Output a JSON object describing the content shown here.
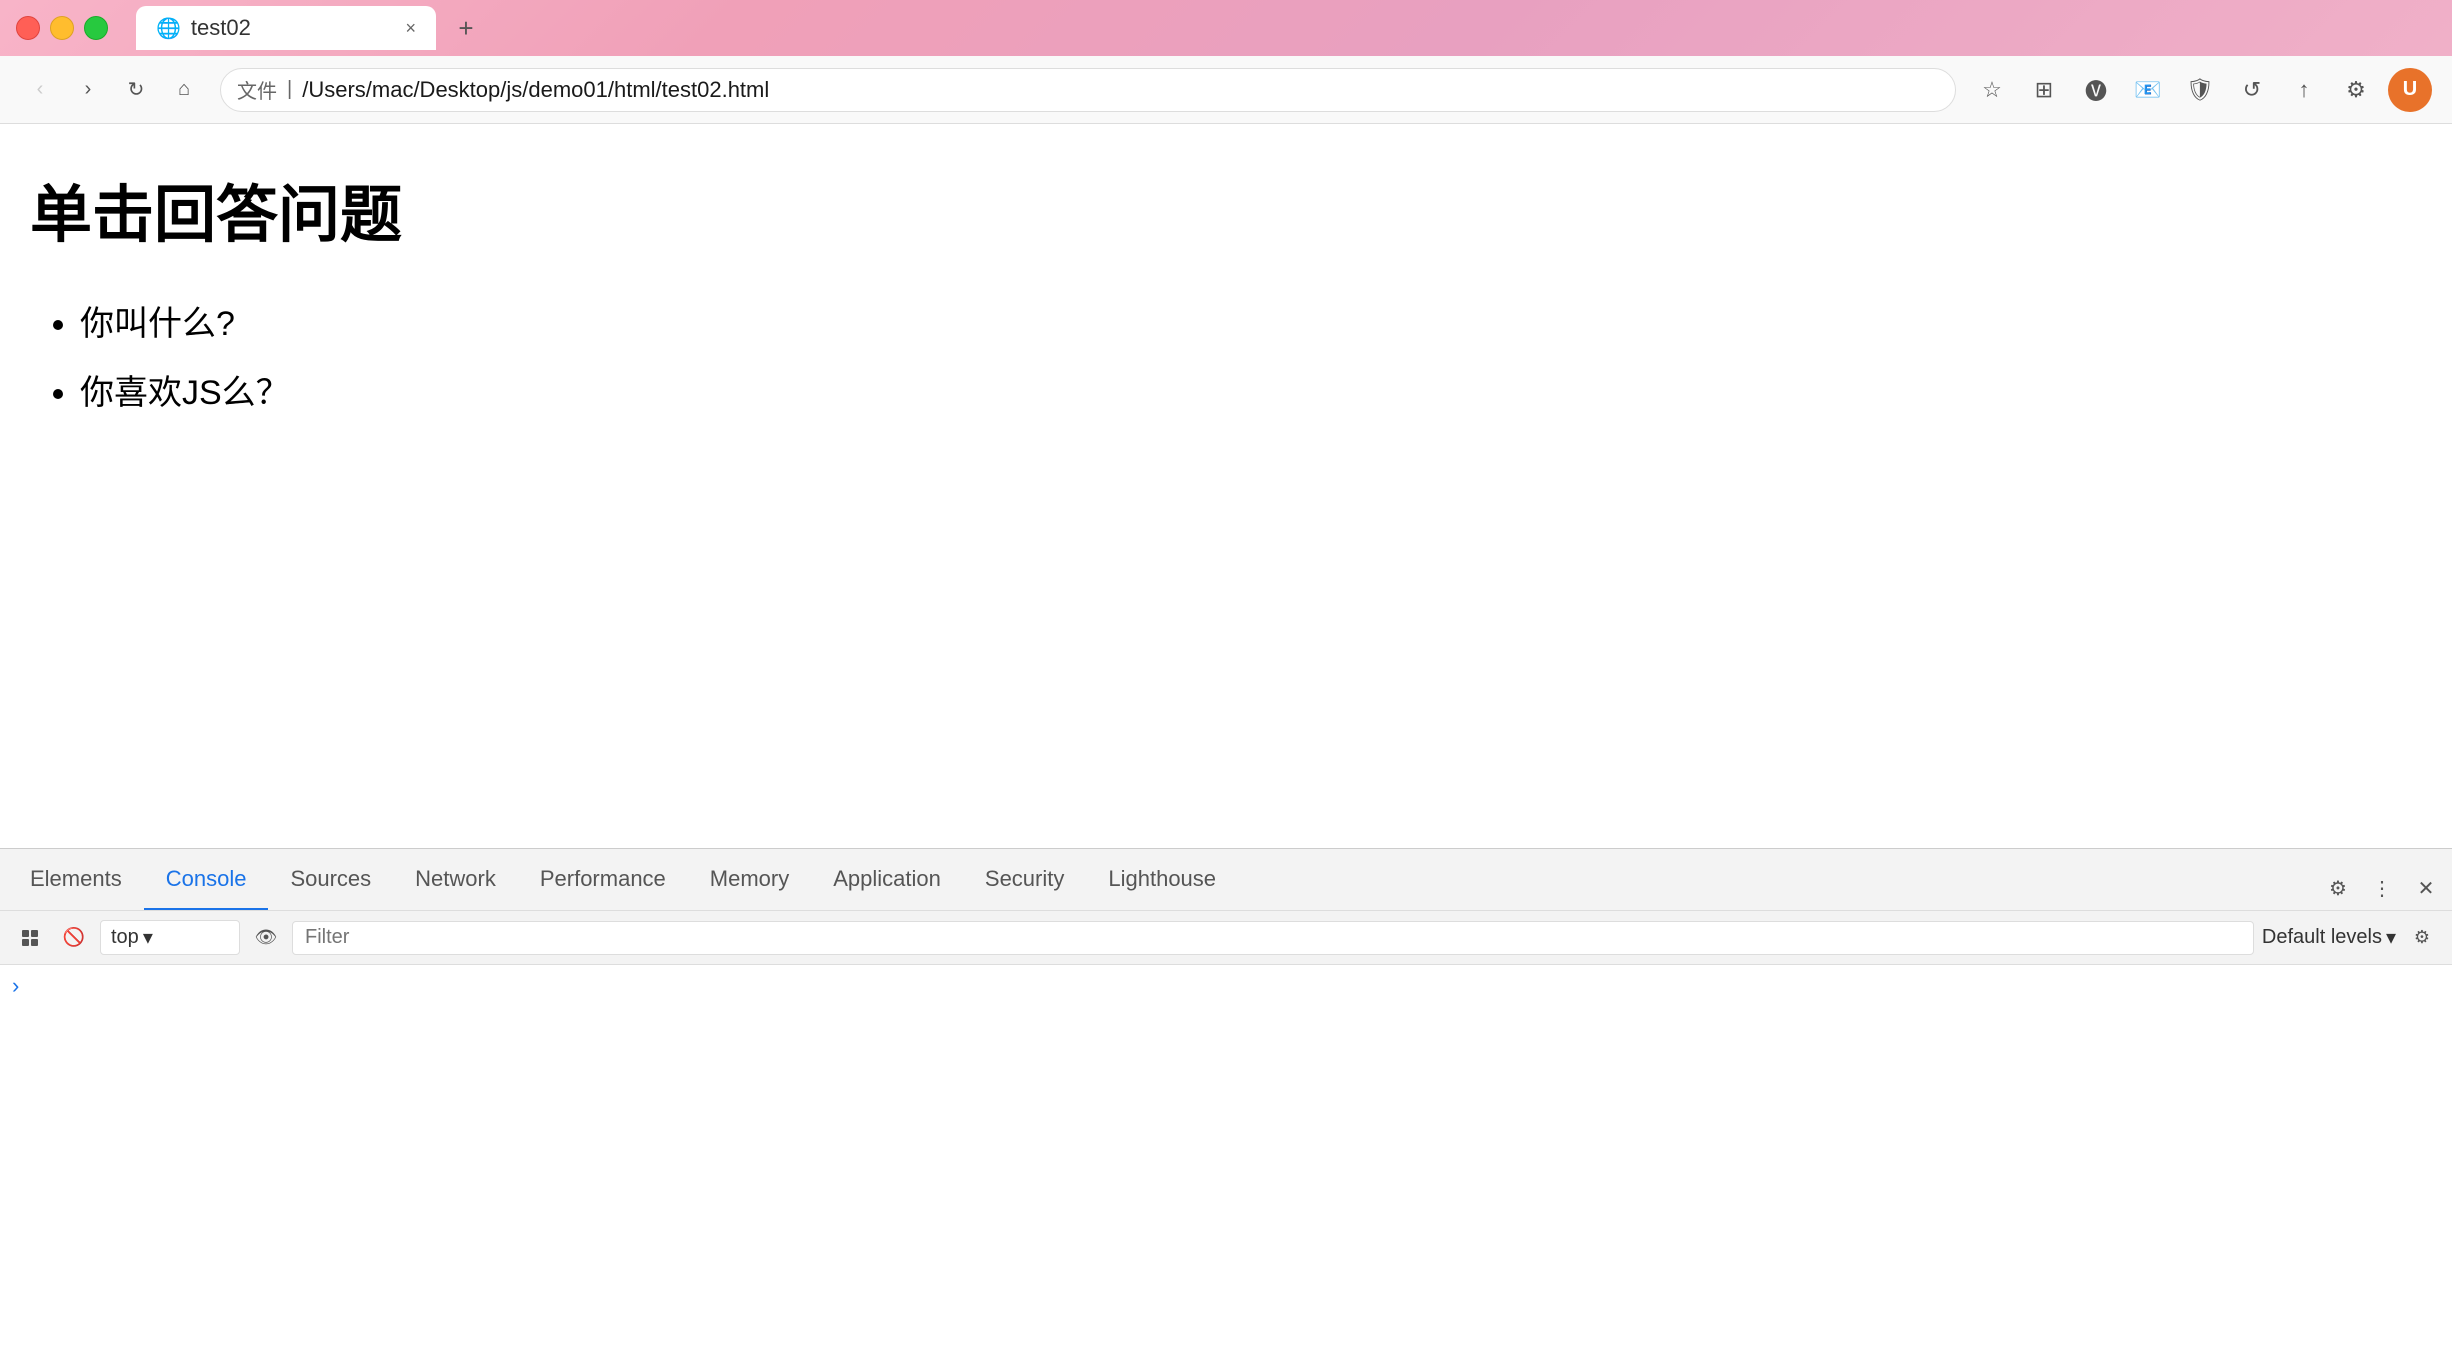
{
  "browser": {
    "tab": {
      "favicon": "🌐",
      "title": "test02",
      "close_label": "×"
    },
    "new_tab_label": "+",
    "nav": {
      "back_label": "‹",
      "forward_label": "›",
      "refresh_label": "↻",
      "home_label": "⌂",
      "protocol": "文件",
      "url": "/Users/mac/Desktop/js/demo01/html/test02.html",
      "bookmark_icon": "☆",
      "user_avatar": "U"
    }
  },
  "page": {
    "title": "单击回答问题",
    "list_items": [
      "你叫什么?",
      "你喜欢JS么？"
    ]
  },
  "devtools": {
    "tabs": [
      {
        "id": "elements",
        "label": "Elements",
        "active": false
      },
      {
        "id": "console",
        "label": "Console",
        "active": true
      },
      {
        "id": "sources",
        "label": "Sources",
        "active": false
      },
      {
        "id": "network",
        "label": "Network",
        "active": false
      },
      {
        "id": "performance",
        "label": "Performance",
        "active": false
      },
      {
        "id": "memory",
        "label": "Memory",
        "active": false
      },
      {
        "id": "application",
        "label": "Application",
        "active": false
      },
      {
        "id": "security",
        "label": "Security",
        "active": false
      },
      {
        "id": "lighthouse",
        "label": "Lighthouse",
        "active": false
      }
    ],
    "console": {
      "context_label": "top",
      "context_arrow": "▾",
      "filter_placeholder": "Filter",
      "levels_label": "Default levels",
      "levels_arrow": "▾"
    }
  }
}
